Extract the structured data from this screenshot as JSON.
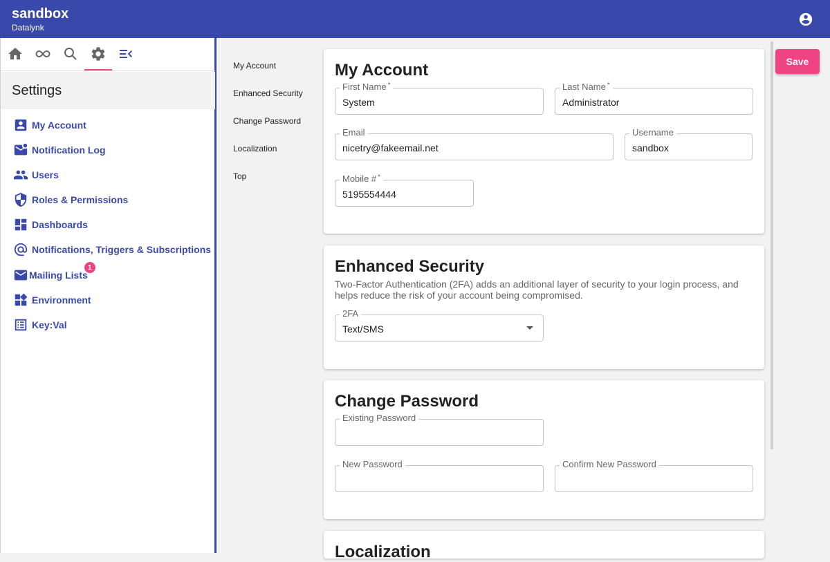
{
  "app": {
    "title": "sandbox",
    "subtitle": "Datalynk"
  },
  "sidebar": {
    "header": "Settings",
    "items": [
      {
        "label": "My Account",
        "icon": "account-box-icon"
      },
      {
        "label": "Notification Log",
        "icon": "mail-badge-icon"
      },
      {
        "label": "Users",
        "icon": "people-icon"
      },
      {
        "label": "Roles & Permissions",
        "icon": "shield-icon"
      },
      {
        "label": "Dashboards",
        "icon": "dashboard-icon"
      },
      {
        "label": "Notifications, Triggers & Subscriptions",
        "icon": "at-sign-icon"
      },
      {
        "label": "Mailing Lists",
        "icon": "mail-icon",
        "badge": "1"
      },
      {
        "label": "Environment",
        "icon": "widgets-icon"
      },
      {
        "label": "Key:Val",
        "icon": "list-icon"
      }
    ]
  },
  "anchors": [
    "My Account",
    "Enhanced Security",
    "Change Password",
    "Localization",
    "Top"
  ],
  "save_label": "Save",
  "my_account": {
    "title": "My Account",
    "first_name": {
      "label": "First Name",
      "value": "System"
    },
    "last_name": {
      "label": "Last Name",
      "value": "Administrator"
    },
    "email": {
      "label": "Email",
      "value": "nicetry@fakeemail.net"
    },
    "username": {
      "label": "Username",
      "value": "sandbox"
    },
    "mobile": {
      "label": "Mobile #",
      "value": "5195554444"
    }
  },
  "enhanced_security": {
    "title": "Enhanced Security",
    "description": "Two-Factor Authentication (2FA) adds an additional layer of security to your login process, and helps reduce the risk of your account being compromised.",
    "twofa": {
      "label": "2FA",
      "value": "Text/SMS"
    }
  },
  "change_password": {
    "title": "Change Password",
    "existing": {
      "label": "Existing Password"
    },
    "new": {
      "label": "New Password"
    },
    "confirm": {
      "label": "Confirm New Password"
    }
  },
  "localization": {
    "title": "Localization"
  },
  "colors": {
    "primary": "#3949ab",
    "accent": "#ef4383"
  }
}
